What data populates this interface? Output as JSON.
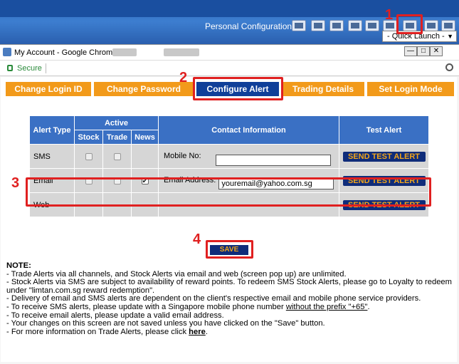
{
  "host": {
    "title": "Personal Configurations",
    "quick_launch": "- Quick Launch -",
    "quick_launch_arrow": "▼",
    "toolbar_icons": [
      "config-icon-1",
      "config-icon-2",
      "edit-icon",
      "config-icon-4",
      "config-icon-5",
      "settings-icon",
      "user-profile-icon",
      "folder-icon",
      "logout-icon"
    ]
  },
  "markers": {
    "m1": "1",
    "m2": "2",
    "m3": "3",
    "m4": "4"
  },
  "browser": {
    "window_title": "My Account - Google Chrome",
    "secure_label": "Secure",
    "minimize": "—",
    "maximize": "□",
    "close": "✕"
  },
  "tabs": [
    {
      "label": "Change Login ID"
    },
    {
      "label": "Change Password"
    },
    {
      "label": "Configure Alert",
      "active": true
    },
    {
      "label": "Trading Details"
    },
    {
      "label": "Set Login Mode"
    }
  ],
  "table": {
    "headers": {
      "alert_type": "Alert Type",
      "active": "Active",
      "contact": "Contact Information",
      "test": "Test Alert",
      "stock": "Stock",
      "trade": "Trade",
      "news": "News"
    },
    "rows": [
      {
        "type": "SMS",
        "stock": false,
        "trade": false,
        "news": null,
        "contact_label": "Mobile No:",
        "contact_value": "",
        "button": "SEND TEST ALERT"
      },
      {
        "type": "Email",
        "stock": false,
        "trade": false,
        "news": true,
        "contact_label": "Email Address:",
        "contact_value": "youremail@yahoo.com.sg",
        "button": "SEND TEST ALERT"
      },
      {
        "type": "Web",
        "stock": null,
        "trade": null,
        "news": null,
        "contact_label": "",
        "contact_value": "",
        "button": "SEND TEST ALERT"
      }
    ]
  },
  "save_label": "SAVE",
  "notes": {
    "heading": "NOTE:",
    "line1": "- Trade Alerts via all channels, and Stock Alerts via email and web (screen pop up) are unlimited.",
    "line2": "- Stock Alerts via SMS are subject to availability of reward points. To redeem SMS Stock Alerts, please go to Loyalty to redeem",
    "line3": "under \"limtan.com.sg reward redemption\".",
    "line4": "- Delivery of email and SMS alerts are dependent on the client's respective email and mobile phone service providers.",
    "line5a": "- To receive SMS alerts, please update with a Singapore mobile phone number ",
    "line5b": "without the prefix \"+65\"",
    "line5c": ".",
    "line6": "- To receive email alerts, please update a valid email address.",
    "line7": "- Your changes on this screen are not saved unless you have clicked on the \"Save\" button.",
    "line8a": "- For more information on Trade Alerts, please click ",
    "line8b": "here",
    "line8c": "."
  },
  "colors": {
    "tab_orange": "#f29a1a",
    "tab_active": "#0f3f99",
    "header_blue": "#3a70c4",
    "button_navy": "#0f2c7a",
    "button_text": "#f2a51a",
    "highlight_red": "#e02020"
  }
}
